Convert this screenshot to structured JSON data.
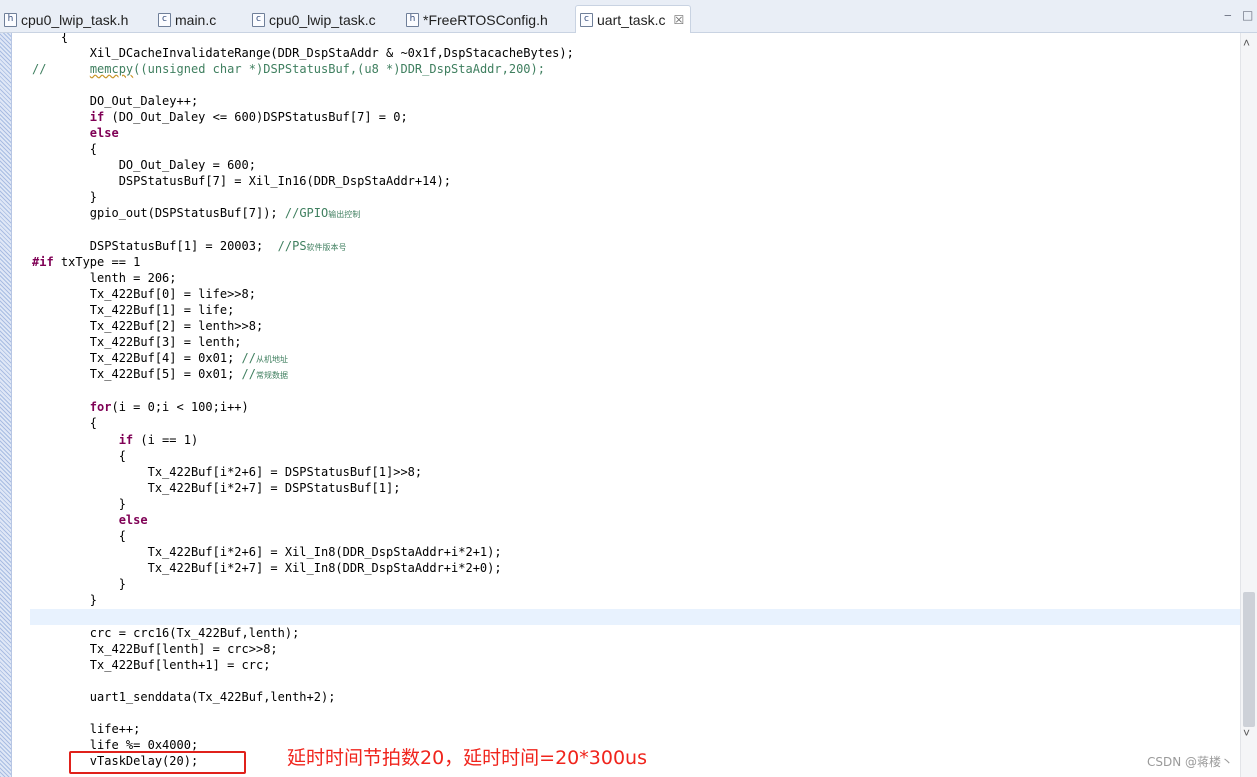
{
  "tabs": [
    {
      "icon_label": "h",
      "title": "cpu0_lwip_task.h"
    },
    {
      "icon_label": "c",
      "title": "main.c"
    },
    {
      "icon_label": "c",
      "title": "cpu0_lwip_task.c"
    },
    {
      "icon_label": "h",
      "title": "*FreeRTOSConfig.h"
    },
    {
      "icon_label": "c",
      "title": "uart_task.c",
      "close": "☒",
      "active": true
    }
  ],
  "window_controls": {
    "minimize": "‒",
    "maximize": "□"
  },
  "code": {
    "l0": "    {",
    "l1": "        Xil_DCacheInvalidateRange(DDR_DspStaAddr & ~0x1f,DspStacacheBytes);",
    "l2_slashes": "//",
    "l2_pad": "      ",
    "l2_memcpy": "memcpy",
    "l2_rest": "((unsigned char *)DSPStatusBuf,(u8 *)DDR_DspStaAddr,200);",
    "l4": "        DO_Out_Daley++;",
    "l5_kw": "if",
    "l5_rest": " (DO_Out_Daley <= 600)DSPStatusBuf[7] = 0;",
    "l6_kw": "else",
    "l7": "        {",
    "l8": "            DO_Out_Daley = 600;",
    "l9": "            DSPStatusBuf[7] = Xil_In16(DDR_DspStaAddr+14);",
    "l10": "        }",
    "l11_code": "        gpio_out(DSPStatusBuf[7]); ",
    "l11_cm": "//GPIO",
    "l11_cm2": "输出控制",
    "l13_code": "        DSPStatusBuf[1] = 20003;  ",
    "l13_cm": "//PS",
    "l13_cm2": "软件版本号",
    "l14_kw": "#if",
    "l14_rest": " txType == 1",
    "l15": "        lenth = 206;",
    "l16": "        Tx_422Buf[0] = life>>8;",
    "l17": "        Tx_422Buf[1] = life;",
    "l18": "        Tx_422Buf[2] = lenth>>8;",
    "l19": "        Tx_422Buf[3] = lenth;",
    "l20_code": "        Tx_422Buf[4] = 0x01; ",
    "l20_cm": "//",
    "l20_cm2": "从机地址",
    "l21_code": "        Tx_422Buf[5] = 0x01; ",
    "l21_cm": "//",
    "l21_cm2": "常规数据",
    "l23_kw": "for",
    "l23_rest": "(i = 0;i < 100;i++)",
    "l24": "        {",
    "l25_kw": "if",
    "l25_rest": " (i == 1)",
    "l26": "            {",
    "l27": "                Tx_422Buf[i*2+6] = DSPStatusBuf[1]>>8;",
    "l28": "                Tx_422Buf[i*2+7] = DSPStatusBuf[1];",
    "l29": "            }",
    "l30_kw": "else",
    "l31": "            {",
    "l32": "                Tx_422Buf[i*2+6] = Xil_In8(DDR_DspStaAddr+i*2+1);",
    "l33": "                Tx_422Buf[i*2+7] = Xil_In8(DDR_DspStaAddr+i*2+0);",
    "l34": "            }",
    "l35": "        }",
    "l37": "        crc = crc16(Tx_422Buf,lenth);",
    "l38": "        Tx_422Buf[lenth] = crc>>8;",
    "l39": "        Tx_422Buf[lenth+1] = crc;",
    "l41": "        uart1_senddata(Tx_422Buf,lenth+2);",
    "l43": "        life++;",
    "l44": "        life %= 0x4000;",
    "l45": "        vTaskDelay(20);"
  },
  "annotation": "延时时间节拍数20，延时时间=20*300us",
  "watermark": "CSDN @蒋楼丶",
  "scrollbar": {
    "up": "˄",
    "down": "˅"
  },
  "colors": {
    "keyword": "#7f0055",
    "comment": "#3f7f5f",
    "current_line": "#e8f2fe",
    "highlight_box": "#e0211b"
  }
}
